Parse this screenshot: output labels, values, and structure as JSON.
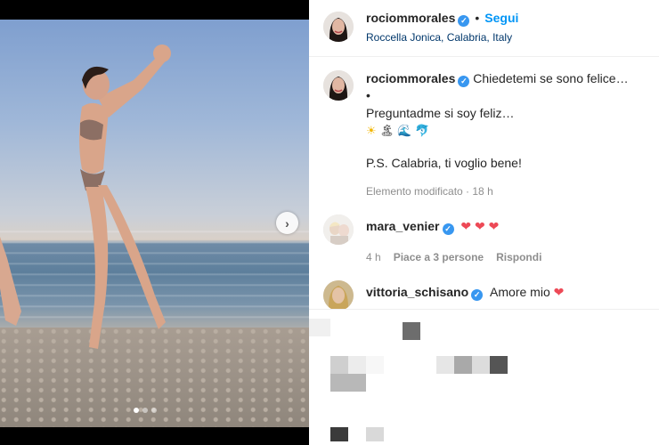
{
  "post": {
    "username": "rociommorales",
    "follow_label": "Segui",
    "location": "Roccella Jonica, Calabria, Italy"
  },
  "caption": {
    "username": "rociommorales",
    "line1": "Chiedetemi se sono felice…",
    "line2": "•",
    "line3": "Preguntadme si soy feliz…",
    "emojis": [
      "☀",
      "🏝",
      "🌊",
      "🐬"
    ],
    "line5": "P.S. Calabria, ti voglio bene!",
    "edited": "Elemento modificato · 18 h"
  },
  "comments": [
    {
      "username": "mara_venier",
      "text": "❤ ❤ ❤",
      "time": "4 h",
      "likes": "Piace a 3 persone",
      "reply": "Rispondi"
    },
    {
      "username": "vittoria_schisano",
      "text": "Amore mio",
      "heart": "❤"
    }
  ],
  "carousel": {
    "next_icon": "chevron-right-icon",
    "dots": 3,
    "active_dot": 1
  },
  "colors": {
    "accent": "#0095f6",
    "verified": "#3897f0",
    "heart": "#ed4956"
  }
}
